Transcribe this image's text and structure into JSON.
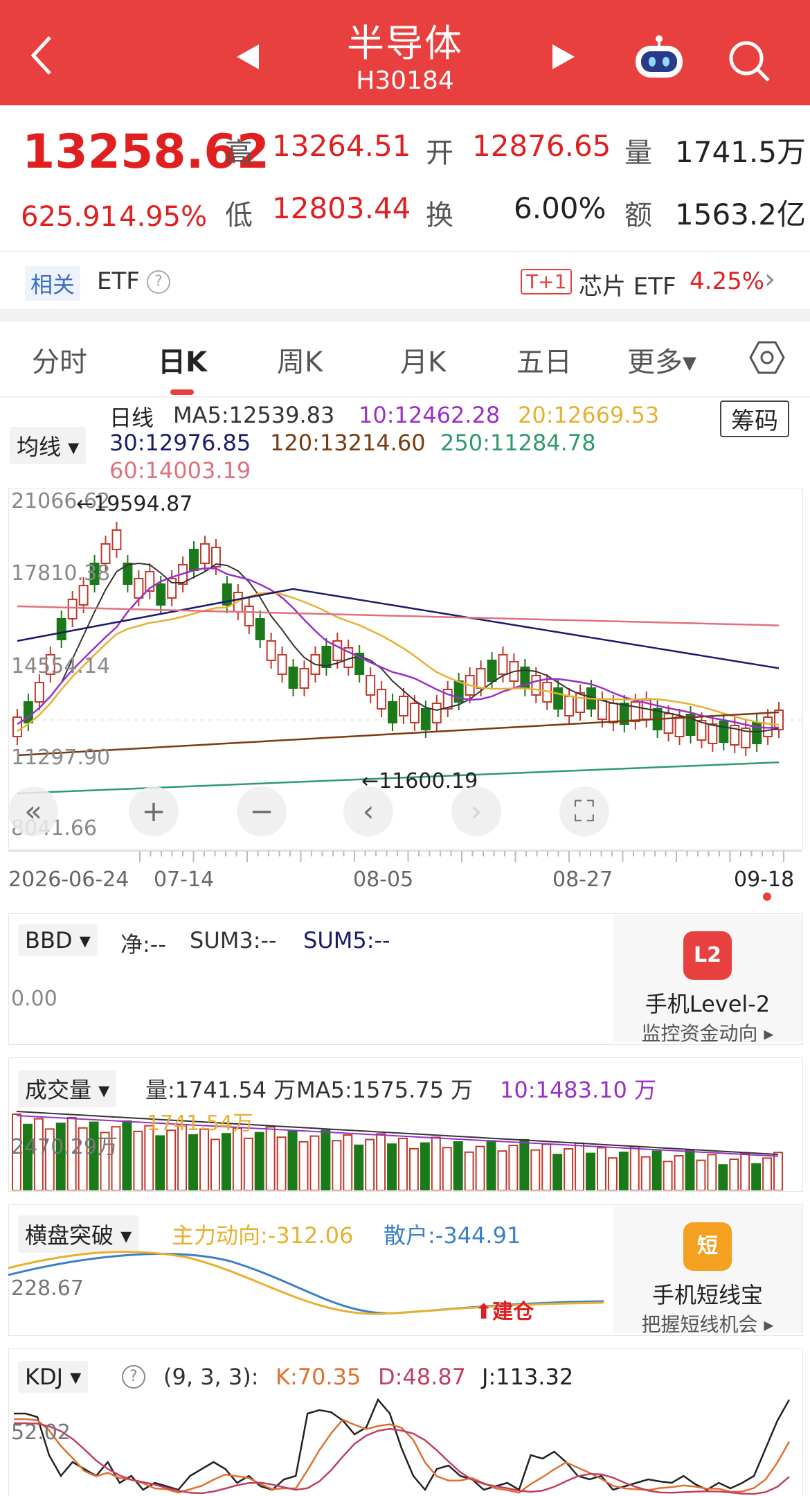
{
  "header": {
    "title": "半导体",
    "code": "H30184",
    "back_icon": "chevron-left-icon",
    "prev_icon": "triangle-left-icon",
    "next_icon": "triangle-right-icon",
    "robot_icon": "robot-icon",
    "search_icon": "search-icon"
  },
  "quote": {
    "price": "13258.62",
    "change": "625.91",
    "change_pct": "4.95%",
    "high_label": "高",
    "high": "13264.51",
    "open_label": "开",
    "open": "12876.65",
    "vol_label": "量",
    "vol": "1741.5万",
    "low_label": "低",
    "low": "12803.44",
    "turn_label": "换",
    "turn": "6.00%",
    "amt_label": "额",
    "amt": "1563.2亿"
  },
  "etf": {
    "tag": "相关",
    "label": "ETF",
    "help": "?",
    "t1": "T+1",
    "name": "芯片 ETF",
    "pct": "4.25%",
    "arrow": "›"
  },
  "tabs": [
    {
      "label": "分时"
    },
    {
      "label": "日K",
      "active": true
    },
    {
      "label": "周K"
    },
    {
      "label": "月K"
    },
    {
      "label": "五日"
    },
    {
      "label": "更多▾"
    }
  ],
  "settings_icon": "hexagon-settings-icon",
  "kline": {
    "ma_dropdown": "均线 ▾",
    "chip_button": "筹码",
    "line_label": "日线",
    "ma5": "MA5:12539.83",
    "ma10": "10:12462.28",
    "ma20": "20:12669.53",
    "ma30": "30:12976.85",
    "ma120": "120:13214.60",
    "ma250": "250:11284.78",
    "ma60": "60:14003.19",
    "ylabels": [
      "21066.62",
      "17810.38",
      "14554.14",
      "11297.90",
      "8041.66"
    ],
    "max_marker": "←19594.87",
    "min_marker": "←11600.19",
    "dates": [
      "2026-06-24",
      "07-14",
      "08-05",
      "08-27",
      "09-18"
    ],
    "controls": [
      "«",
      "+",
      "−",
      "‹",
      "›",
      "⛶"
    ]
  },
  "bbd": {
    "dropdown": "BBD ▾",
    "net": "净:--",
    "sum3": "SUM3:--",
    "sum5": "SUM5:--",
    "ylabel": "0.00"
  },
  "ad1": {
    "badge": "L2",
    "title": "手机Level-2",
    "sub": "监控资金动向 ▸"
  },
  "volume": {
    "dropdown": "成交量 ▾",
    "vol": "量:1741.54 万",
    "ma5": "MA5:1575.75 万",
    "ma10": "10:1483.10 万",
    "overlay1": "1741.54万",
    "overlay2": "2470.29万"
  },
  "breakout": {
    "dropdown": "横盘突破 ▾",
    "main": "主力动向:-312.06",
    "retail": "散户:-344.91",
    "ylabel": "228.67",
    "signal": "建仓"
  },
  "ad2": {
    "badge": "短",
    "title": "手机短线宝",
    "sub": "把握短线机会 ▸"
  },
  "kdj": {
    "dropdown": "KDJ ▾",
    "help": "?",
    "params": "(9, 3, 3):",
    "k": "K:70.35",
    "d": "D:48.87",
    "j": "J:113.32",
    "ylabel": "52.02"
  },
  "colors": {
    "red": "#e8403f",
    "up": "#c0392b",
    "down": "#1a7a1a",
    "ma5": "#333333",
    "ma10": "#9b30c8",
    "ma20": "#e8b030",
    "ma30": "#1b1b6b",
    "ma120": "#7a3a10",
    "ma250": "#2e9a6e",
    "ma60": "#e07080"
  }
}
